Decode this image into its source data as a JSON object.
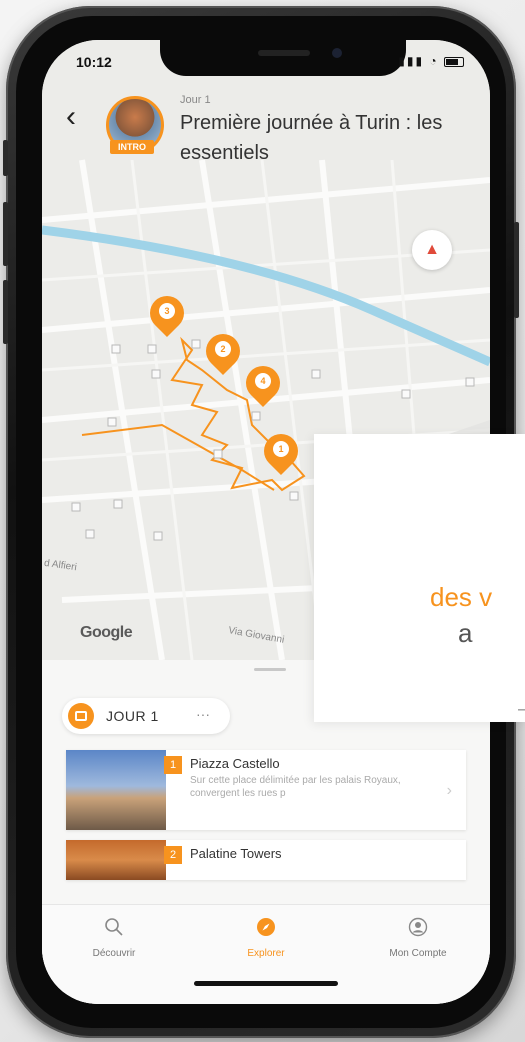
{
  "status_bar": {
    "time": "10:12"
  },
  "header": {
    "day_small": "Jour 1",
    "title": "Première journée à Turin : les essentiels",
    "intro_badge": "INTRO"
  },
  "map": {
    "google_logo": "Google",
    "street_labels": [
      "Via Giovanni",
      "d Alfieri"
    ],
    "pins": [
      {
        "label": "1",
        "number": 1
      },
      {
        "label": "2",
        "number": 2
      },
      {
        "label": "3",
        "number": 3
      },
      {
        "label": "4",
        "number": 4
      }
    ]
  },
  "day_chip": {
    "label": "JOUR 1",
    "more": "···"
  },
  "places": [
    {
      "number": "1",
      "name": "Piazza Castello",
      "description": "Sur cette place délimitée par les palais Royaux, convergent les rues p"
    },
    {
      "number": "2",
      "name": "Palatine Towers",
      "description": ""
    }
  ],
  "tabs": [
    {
      "label": "Découvrir",
      "icon": "search-icon",
      "active": false
    },
    {
      "label": "Explorer",
      "icon": "compass-icon",
      "active": true
    },
    {
      "label": "Mon Compte",
      "icon": "account-icon",
      "active": false
    }
  ],
  "overlay": {
    "line1": "des v",
    "line2": "a",
    "dash": "–"
  },
  "colors": {
    "accent": "#f7931e",
    "river": "#9fd3e8"
  }
}
